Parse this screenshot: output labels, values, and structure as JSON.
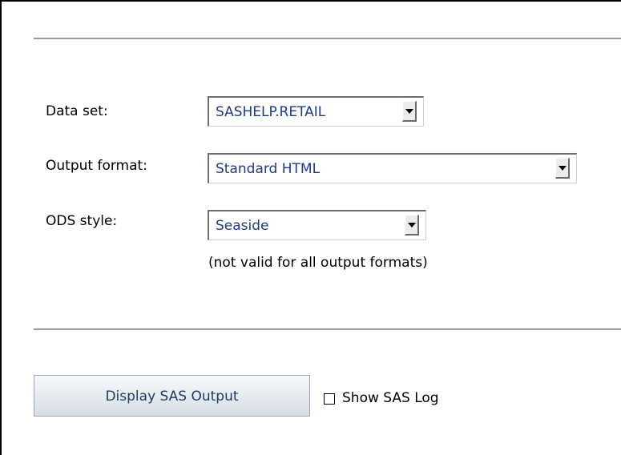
{
  "form": {
    "dataset": {
      "label": "Data set:",
      "selected": "SASHELP.RETAIL"
    },
    "output_format": {
      "label": "Output format:",
      "selected": "Standard HTML"
    },
    "ods_style": {
      "label": "ODS style:",
      "selected": "Seaside",
      "note": "(not valid for all output formats)"
    }
  },
  "actions": {
    "display_button_label": "Display SAS Output",
    "show_log_label": "Show SAS Log",
    "show_log_checked": false
  },
  "colors": {
    "select_text": "#1e3b8a",
    "button_text": "#1e3b66",
    "rule": "#9c9c9c"
  }
}
